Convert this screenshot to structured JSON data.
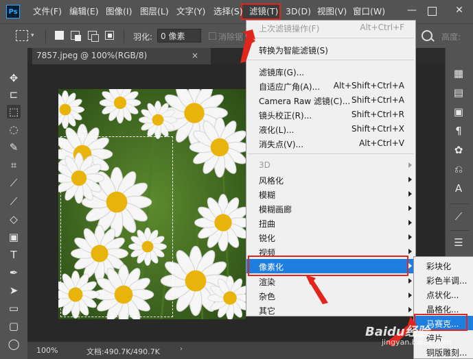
{
  "app": {
    "logo": "Ps"
  },
  "menubar": {
    "items": [
      "文件(F)",
      "编辑(E)",
      "图像(I)",
      "图层(L)",
      "文字(Y)",
      "选择(S)",
      "滤镜(T)",
      "3D(D)",
      "视图(V)",
      "窗口(W)"
    ],
    "active": "滤镜(T)",
    "window_controls": [
      "minimize",
      "restore",
      "close"
    ]
  },
  "options": {
    "feather_label": "羽化:",
    "feather_value": "0 像素",
    "smooth_label": "消除锯",
    "height_label": "高度:"
  },
  "document": {
    "tab_title": "7857.jpeg @ 100%(RGB/8)",
    "close": "×"
  },
  "status": {
    "zoom": "100%",
    "doc_info": "文档:490.7K/490.7K"
  },
  "filter_menu": {
    "items": [
      {
        "label": "上次滤镜操作(F)",
        "shortcut": "Alt+Ctrl+F",
        "disabled": true
      },
      {
        "label": "转换为智能滤镜(S)",
        "shortcut": ""
      },
      {
        "label": "滤镜库(G)...",
        "shortcut": ""
      },
      {
        "label": "自适应广角(A)...",
        "shortcut": "Alt+Shift+Ctrl+A"
      },
      {
        "label": "Camera Raw 滤镜(C)...",
        "shortcut": "Shift+Ctrl+A"
      },
      {
        "label": "镜头校正(R)...",
        "shortcut": "Shift+Ctrl+R"
      },
      {
        "label": "液化(L)...",
        "shortcut": "Shift+Ctrl+X"
      },
      {
        "label": "消失点(V)...",
        "shortcut": "Alt+Ctrl+V"
      },
      {
        "label": "3D",
        "submenu": true,
        "disabled": true
      },
      {
        "label": "风格化",
        "submenu": true
      },
      {
        "label": "模糊",
        "submenu": true
      },
      {
        "label": "模糊画廊",
        "submenu": true
      },
      {
        "label": "扭曲",
        "submenu": true
      },
      {
        "label": "锐化",
        "submenu": true
      },
      {
        "label": "视频",
        "submenu": true
      },
      {
        "label": "像素化",
        "submenu": true,
        "highlighted": true
      },
      {
        "label": "渲染",
        "submenu": true
      },
      {
        "label": "杂色",
        "submenu": true
      },
      {
        "label": "其它",
        "submenu": true
      }
    ]
  },
  "pixelate_submenu": {
    "items": [
      "彩块化",
      "彩色半调...",
      "点状化...",
      "晶格化...",
      "马赛克...",
      "碎片",
      "铜版雕刻..."
    ],
    "highlighted": "马赛克..."
  },
  "watermark": {
    "text": "Baidu经验",
    "sub": "jingyan.baidu.com"
  },
  "colors": {
    "accent_highlight": "#1e7ee0",
    "annotation_red": "#e0261f",
    "menu_bg": "#f0f0f0",
    "ui_bg": "#535353"
  }
}
